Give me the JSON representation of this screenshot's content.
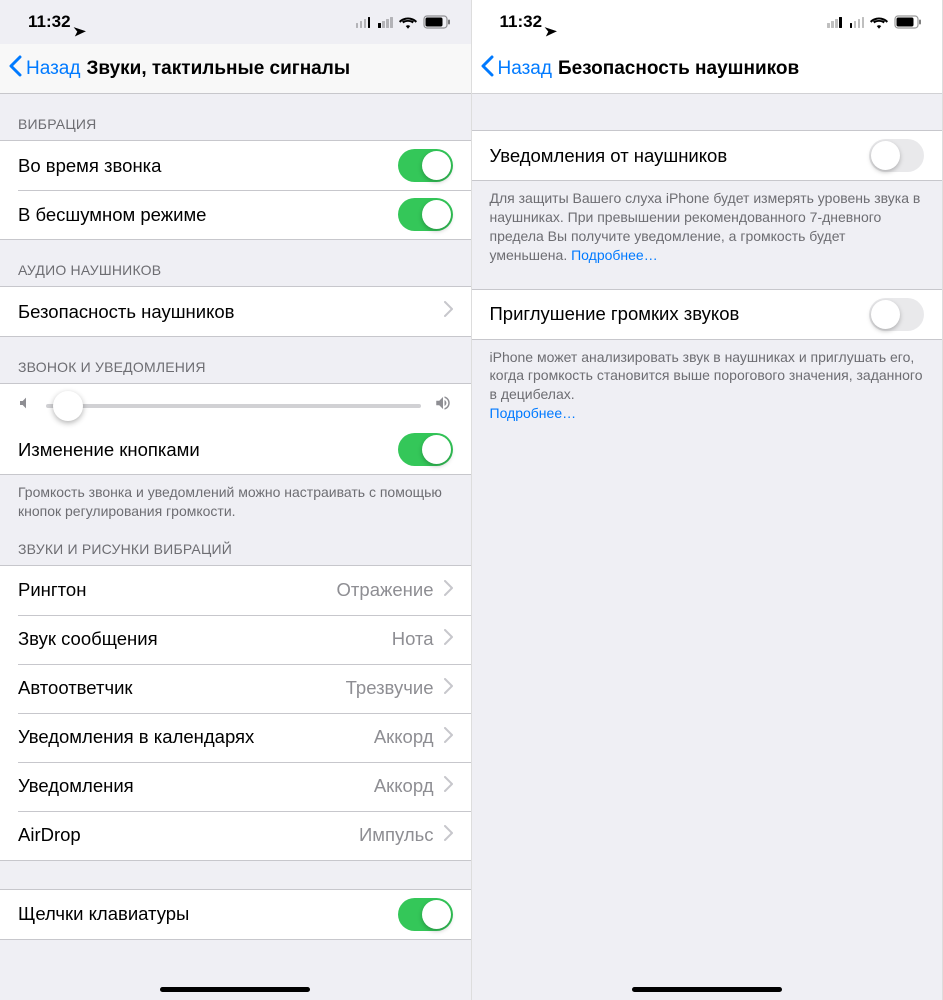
{
  "status": {
    "time": "11:32"
  },
  "screen1": {
    "back": "Назад",
    "title": "Звуки, тактильные сигналы",
    "sections": {
      "vibration": {
        "header": "ВИБРАЦИЯ",
        "ring": "Во время звонка",
        "silent": "В бесшумном режиме"
      },
      "headphone_audio": {
        "header": "АУДИО НАУШНИКОВ",
        "safety": "Безопасность наушников"
      },
      "ringer": {
        "header": "ЗВОНОК И УВЕДОМЛЕНИЯ",
        "change_buttons": "Изменение кнопками",
        "footer": "Громкость звонка и уведомлений можно настраивать с помощью кнопок регулирования громкости."
      },
      "sounds_patterns": {
        "header": "ЗВУКИ И РИСУНКИ ВИБРАЦИЙ",
        "items": [
          {
            "label": "Рингтон",
            "value": "Отражение"
          },
          {
            "label": "Звук сообщения",
            "value": "Нота"
          },
          {
            "label": "Автоответчик",
            "value": "Трезвучие"
          },
          {
            "label": "Уведомления в календарях",
            "value": "Аккорд"
          },
          {
            "label": "Уведомления",
            "value": "Аккорд"
          },
          {
            "label": "AirDrop",
            "value": "Импульс"
          }
        ]
      },
      "keyboard_clicks": "Щелчки клавиатуры"
    },
    "slider_value_percent": 6
  },
  "screen2": {
    "back": "Назад",
    "title": "Безопасность наушников",
    "notifications": {
      "label": "Уведомления от наушников",
      "footer": "Для защиты Вашего слуха iPhone будет измерять уровень звука в наушниках. При превышении рекомендованного 7-дневного предела Вы получите уведомление, а громкость будет уменьшена.",
      "more": "Подробнее…"
    },
    "reduce": {
      "label": "Приглушение громких звуков",
      "footer": "iPhone может анализировать звук в наушниках и приглушать его, когда громкость становится выше порогового значения, заданного в децибелах.",
      "more": "Подробнее…"
    }
  }
}
